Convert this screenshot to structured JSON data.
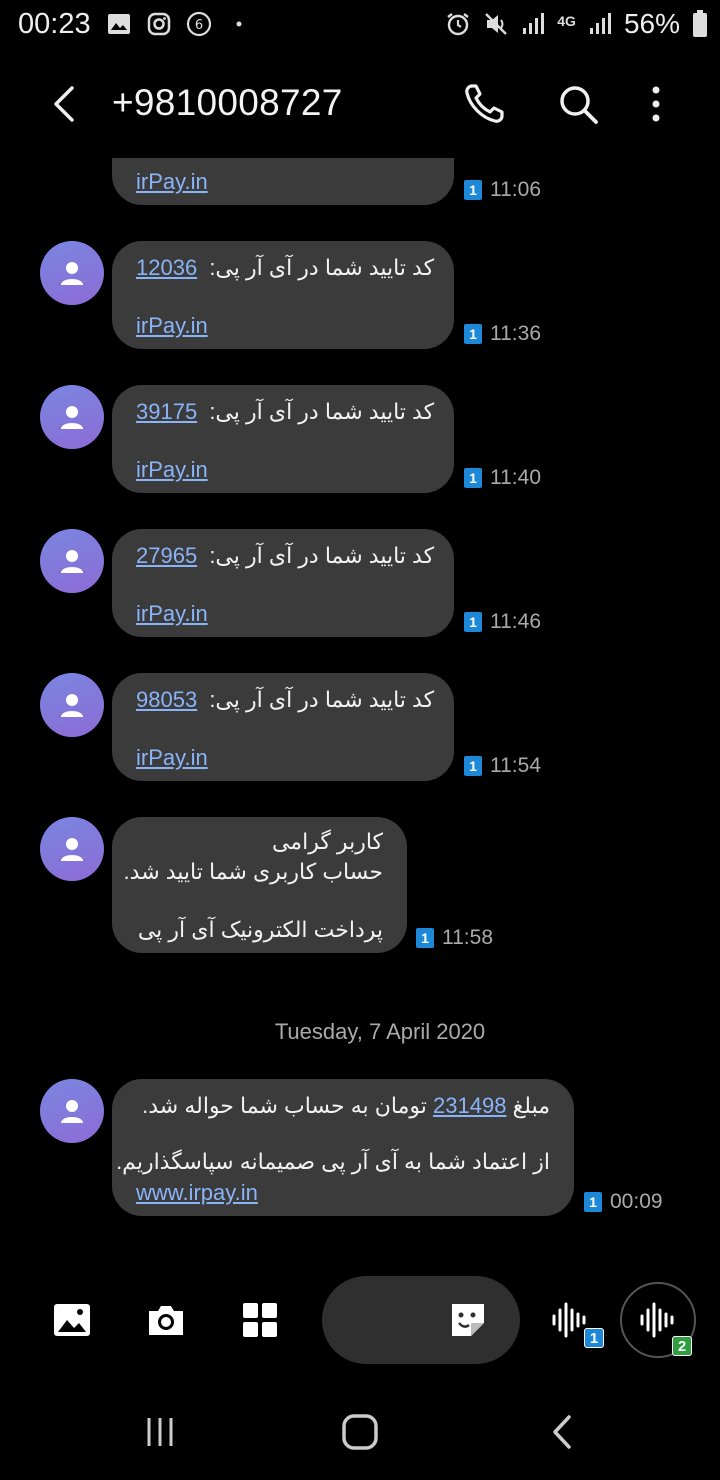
{
  "status_bar": {
    "time": "00:23",
    "network": "4G",
    "battery": "56%"
  },
  "app_bar": {
    "contact": "+9810008727"
  },
  "messages": [
    {
      "lines": [
        "irPay.in"
      ],
      "time": "11:06",
      "sim": "1"
    },
    {
      "code_prefix": "کد تایید شما در آی آر پی:",
      "code": "12036",
      "link": "irPay.in",
      "time": "11:36",
      "sim": "1"
    },
    {
      "code_prefix": "کد تایید شما در آی آر پی:",
      "code": "39175",
      "link": "irPay.in",
      "time": "11:40",
      "sim": "1"
    },
    {
      "code_prefix": "کد تایید شما در آی آر پی:",
      "code": "27965",
      "link": "irPay.in",
      "time": "11:46",
      "sim": "1"
    },
    {
      "code_prefix": "کد تایید شما در آی آر پی:",
      "code": "98053",
      "link": "irPay.in",
      "time": "11:54",
      "sim": "1"
    },
    {
      "lines": [
        "کاربر گرامی",
        "حساب کاربری شما تایید شد.",
        "پرداخت الکترونیک آی آر پی"
      ],
      "time": "11:58",
      "sim": "1"
    }
  ],
  "date_divider": "Tuesday, 7 April 2020",
  "last_message": {
    "prefix": "مبلغ",
    "amount": "231498",
    "suffix": "تومان به حساب شما حواله شد.",
    "line2": "از اعتماد شما به آی آر پی صمیمانه سپاسگذاریم.",
    "link": "www.irpay.in",
    "time": "00:09",
    "sim": "1"
  },
  "composer": {
    "voice_sim1_badge": "1",
    "voice_sim2_badge": "2"
  },
  "colors": {
    "bubble": "#3b3b3b",
    "link": "#8ab4f8",
    "sim1": "#1e88d8",
    "sim2": "#2e9e3e"
  }
}
